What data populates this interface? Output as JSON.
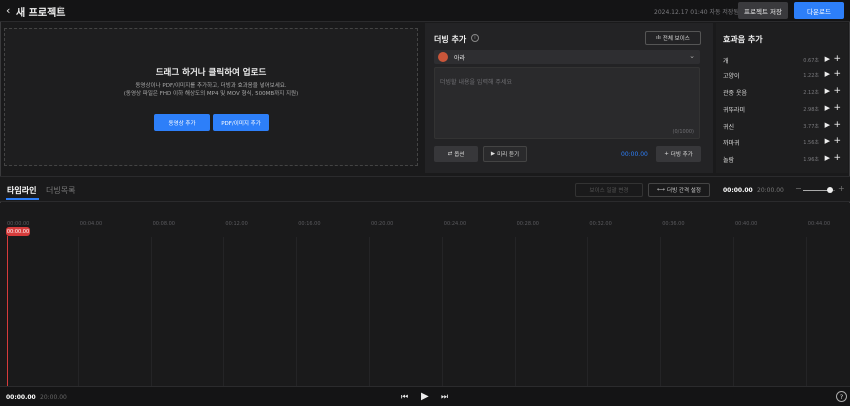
{
  "header": {
    "back_icon": "chevron-left-icon",
    "title": "새 프로젝트",
    "saved_text": "2024.12.17 01:40 자동 저장됨",
    "save_label": "프로젝트 저장",
    "download_label": "다운로드"
  },
  "upload": {
    "title": "드래그 하거나 클릭하여 업로드",
    "desc_line1": "동영상이나 PDF/이미지를 추가하고, 더빙과 효과음을 넣어보세요.",
    "desc_line2": "(동영상 파일은 FHD 이하 해상도의 MP4 및 MOV 형식, 500MB까지 지원)",
    "video_button": "동영상 추가",
    "pdf_button": "PDF/이미지 추가"
  },
  "dubbing": {
    "title": "더빙 추가",
    "all_voice_label": "전체 보이스",
    "voice_name": "아라",
    "text_placeholder": "더빙할 내용을 입력해 주세요",
    "char_count": "(0/1000)",
    "option_label": "옵션",
    "preview_label": "미리 듣기",
    "time": "00:00.00",
    "add_label": "더빙 추가"
  },
  "effects": {
    "title": "효과음 추가",
    "items": [
      {
        "name": "개",
        "duration": "0.67초"
      },
      {
        "name": "고양이",
        "duration": "1.22초"
      },
      {
        "name": "관중 웃음",
        "duration": "2.12초"
      },
      {
        "name": "귀뚜라미",
        "duration": "2.98초"
      },
      {
        "name": "귀신",
        "duration": "3.77초"
      },
      {
        "name": "까마귀",
        "duration": "1.56초"
      },
      {
        "name": "놀람",
        "duration": "1.96초"
      }
    ]
  },
  "timeline": {
    "tab_timeline": "타임라인",
    "tab_dublist": "더빙목록",
    "voice_change_label": "보이스 일괄 변경",
    "interval_label": "더빙 간격 설정",
    "current": "00:00.00",
    "total": "20:00.00",
    "zoom_level": 0.8,
    "playhead_label": "00:00.00",
    "ticks": [
      "00:00.00",
      "00:04.00",
      "00:08.00",
      "00:12.00",
      "00:16.00",
      "00:20.00",
      "00:24.00",
      "00:28.00",
      "00:32.00",
      "00:36.00",
      "00:40.00",
      "00:44.00"
    ]
  },
  "footer": {
    "current": "00:00.00",
    "total": "20:00.00",
    "help": "?"
  },
  "colors": {
    "accent": "#2d7ff9",
    "playhead": "#d63b3b",
    "background": "#1a1a1b"
  }
}
